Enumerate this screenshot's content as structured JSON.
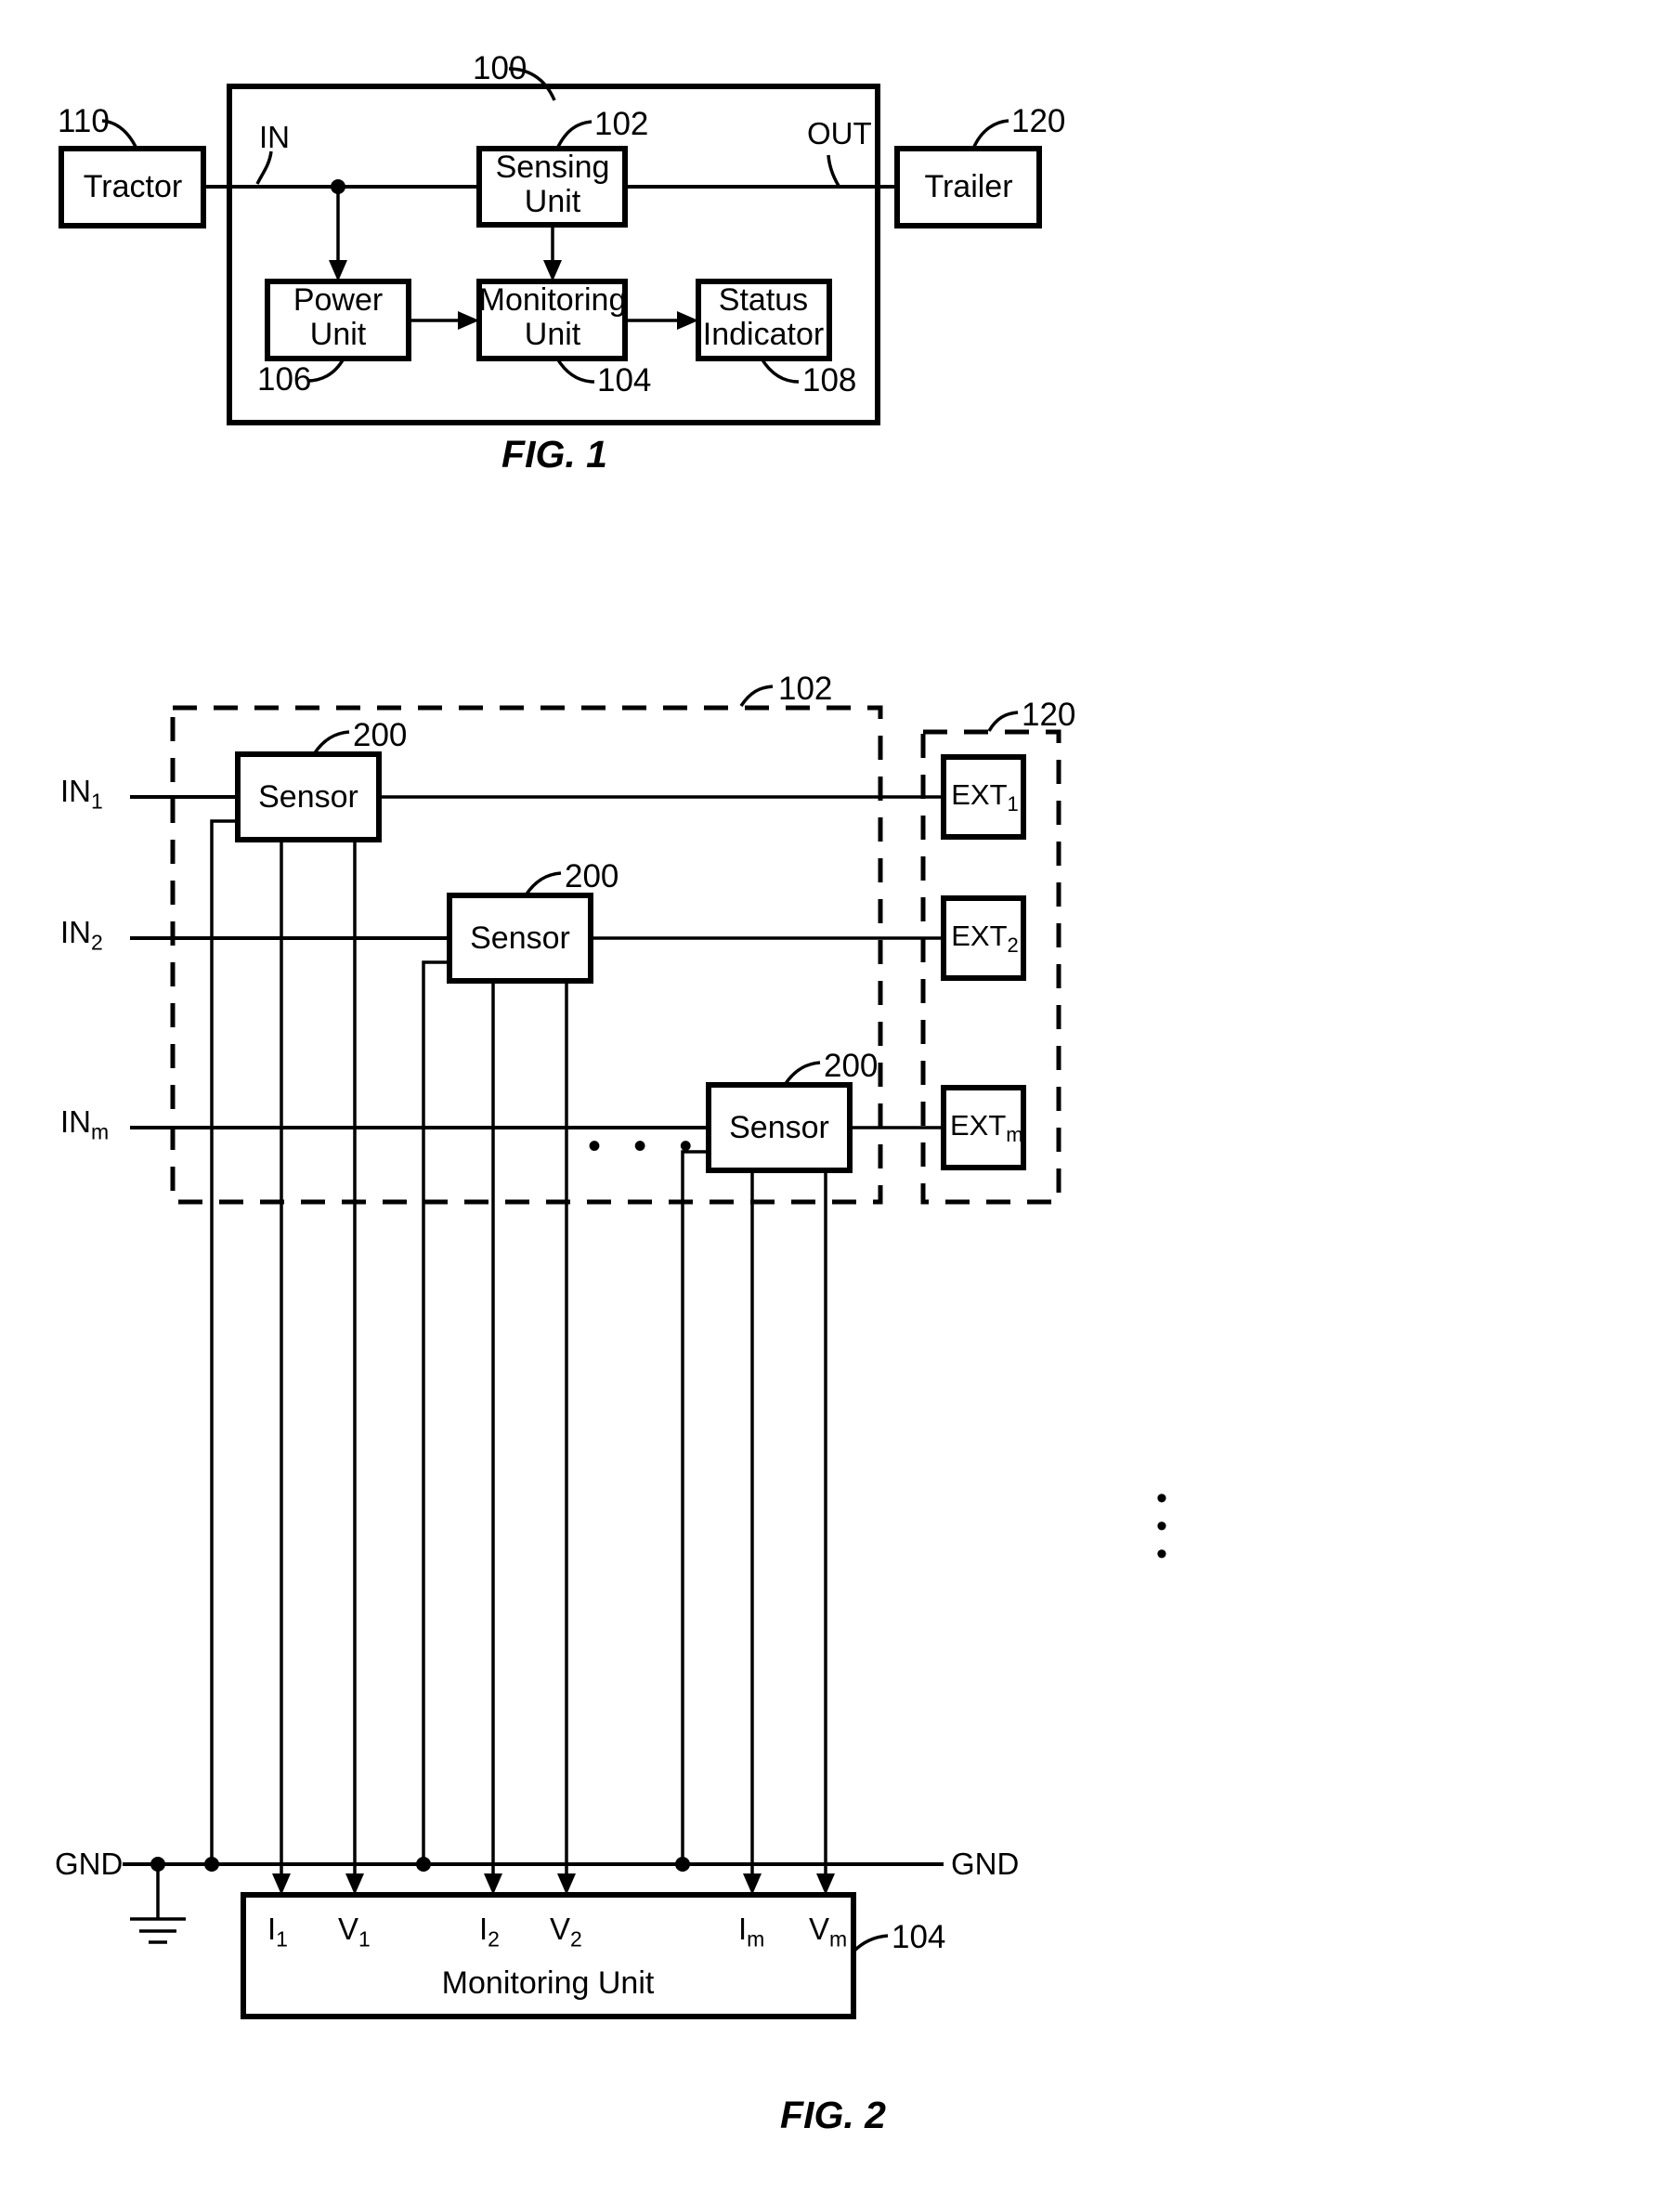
{
  "document": {
    "type": "patent-drawing-sheet",
    "figures": [
      {
        "caption": "FIG. 1",
        "ref_numerals": [
          "100",
          "102",
          "104",
          "106",
          "108",
          "110",
          "120"
        ],
        "blocks": [
          {
            "id": "tractor",
            "label": "Tractor",
            "ref": "110"
          },
          {
            "id": "sensing-unit",
            "label_line1": "Sensing",
            "label_line2": "Unit",
            "ref": "102"
          },
          {
            "id": "trailer",
            "label": "Trailer",
            "ref": "120"
          },
          {
            "id": "power-unit",
            "label_line1": "Power",
            "label_line2": "Unit",
            "ref": "106"
          },
          {
            "id": "monitoring-unit",
            "label_line1": "Monitoring",
            "label_line2": "Unit",
            "ref": "104"
          },
          {
            "id": "status-indicator",
            "label_line1": "Status",
            "label_line2": "Indicator",
            "ref": "108"
          }
        ],
        "port_labels": {
          "input": "IN",
          "output": "OUT"
        },
        "system_ref": "100"
      },
      {
        "caption": "FIG. 2",
        "ref_numerals": [
          "102",
          "104",
          "120",
          "200"
        ],
        "sensing_unit_ref": "102",
        "external_group_ref": "120",
        "monitoring_unit_ref": "104",
        "monitoring_unit_label": "Monitoring Unit",
        "sensor_label": "Sensor",
        "sensor_ref": "200",
        "rows": [
          {
            "input": "IN",
            "input_sub": "1",
            "external": "EXT",
            "external_sub": "1",
            "current": "I",
            "current_sub": "1",
            "voltage": "V",
            "voltage_sub": "1"
          },
          {
            "input": "IN",
            "input_sub": "2",
            "external": "EXT",
            "external_sub": "2",
            "current": "I",
            "current_sub": "2",
            "voltage": "V",
            "voltage_sub": "2"
          },
          {
            "input": "IN",
            "input_sub": "m",
            "external": "EXT",
            "external_sub": "m",
            "current": "I",
            "current_sub": "m",
            "voltage": "V",
            "voltage_sub": "m"
          }
        ],
        "ground_label_left": "GND",
        "ground_label_right": "GND",
        "ellipsis_horizontal": "• • •",
        "ellipsis_vertical": "•"
      }
    ]
  },
  "colors": {
    "ink": "#000000",
    "paper": "#ffffff"
  }
}
